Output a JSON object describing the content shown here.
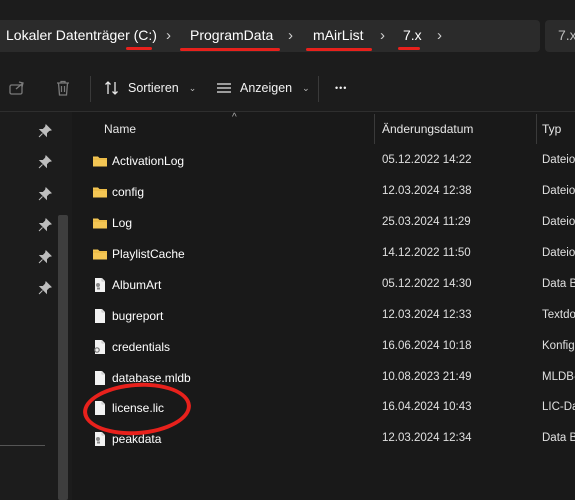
{
  "breadcrumb": {
    "items": [
      {
        "label": "Lokaler Datenträger (C:)"
      },
      {
        "label": "ProgramData"
      },
      {
        "label": "mAirList"
      },
      {
        "label": "7.x"
      }
    ],
    "separator": "›",
    "overflow_label": "7.x"
  },
  "toolbar": {
    "sort_label": "Sortieren",
    "view_label": "Anzeigen",
    "more_label": "•••"
  },
  "columns": {
    "name": "Name",
    "date": "Änderungsdatum",
    "type": "Typ"
  },
  "files": [
    {
      "name": "ActivationLog",
      "date": "05.12.2022 14:22",
      "type": "Dateio",
      "icon": "folder-icon"
    },
    {
      "name": "config",
      "date": "12.03.2024 12:38",
      "type": "Dateio",
      "icon": "folder-icon"
    },
    {
      "name": "Log",
      "date": "25.03.2024 11:29",
      "type": "Dateio",
      "icon": "folder-icon"
    },
    {
      "name": "PlaylistCache",
      "date": "14.12.2022 11:50",
      "type": "Dateio",
      "icon": "folder-icon"
    },
    {
      "name": "AlbumArt",
      "date": "05.12.2022 14:30",
      "type": "Data B",
      "icon": "data-file-icon"
    },
    {
      "name": "bugreport",
      "date": "12.03.2024 12:33",
      "type": "Textdo",
      "icon": "file-icon"
    },
    {
      "name": "credentials",
      "date": "16.06.2024 10:18",
      "type": "Konfig",
      "icon": "config-file-icon"
    },
    {
      "name": "database.mldb",
      "date": "10.08.2023 21:49",
      "type": "MLDB-",
      "icon": "file-icon"
    },
    {
      "name": "license.lic",
      "date": "16.04.2024 10:43",
      "type": "LIC-Da",
      "icon": "file-icon"
    },
    {
      "name": "peakdata",
      "date": "12.03.2024 12:34",
      "type": "Data B",
      "icon": "data-file-icon"
    }
  ],
  "colors": {
    "background": "#1c1c1c",
    "folder": "#f4c654",
    "annotation": "#e8211c"
  }
}
